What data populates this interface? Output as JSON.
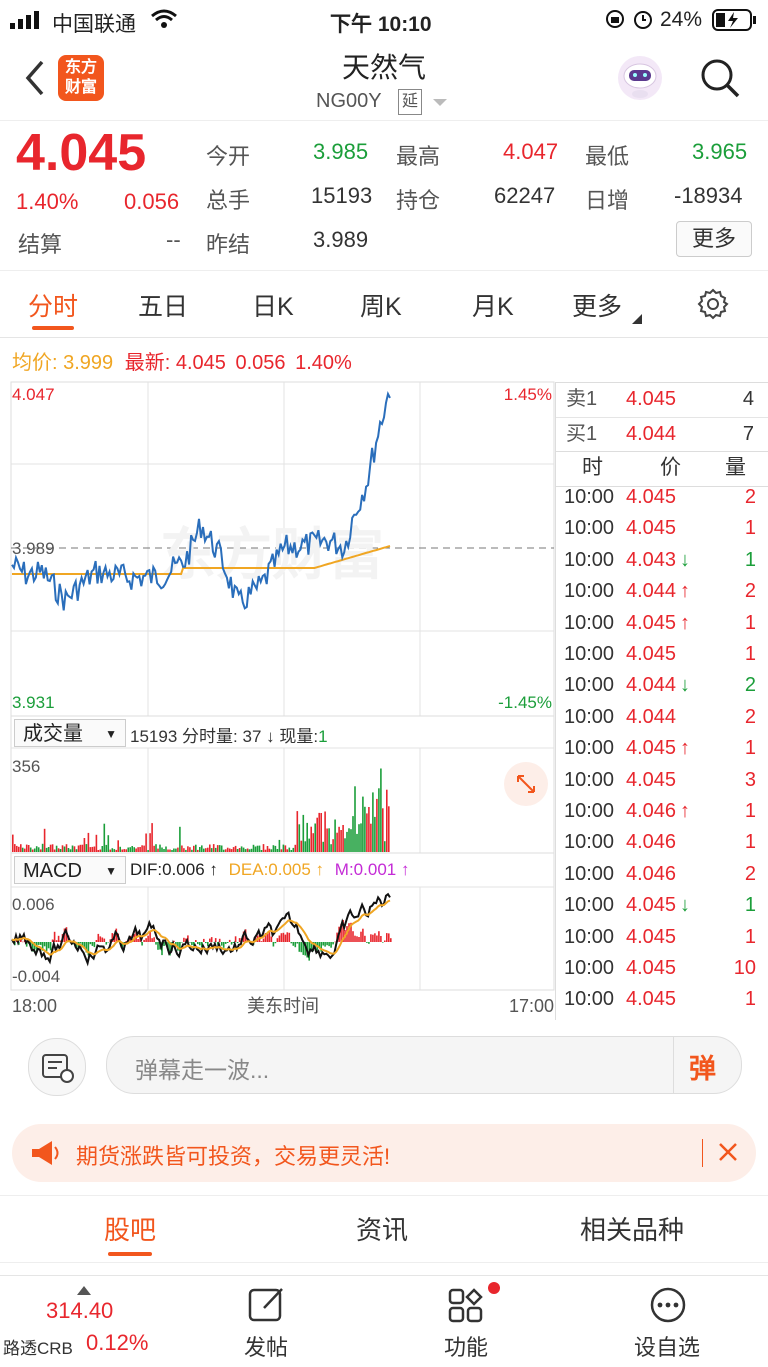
{
  "status_bar": {
    "carrier": "中国联通",
    "time": "下午 10:10",
    "battery": "24%"
  },
  "header": {
    "back_icon": "back-arrow-icon",
    "logo_line1": "东方",
    "logo_line2": "财富",
    "title": "天然气",
    "code": "NG00Y",
    "delay_badge": "延"
  },
  "quote": {
    "price": "4.045",
    "change_pct": "1.40%",
    "change": "0.056",
    "settle_label": "结算",
    "settle_value": "--",
    "open_label": "今开",
    "open_value": "3.985",
    "high_label": "最高",
    "high_value": "4.047",
    "low_label": "最低",
    "low_value": "3.965",
    "volume_label": "总手",
    "volume_value": "15193",
    "oi_label": "持仓",
    "oi_value": "62247",
    "daily_inc_label": "日增",
    "daily_inc_value": "-18934",
    "prev_settle_label": "昨结",
    "prev_settle_value": "3.989",
    "more_button": "更多"
  },
  "tabs": [
    "分时",
    "五日",
    "日K",
    "周K",
    "月K",
    "更多"
  ],
  "chart_header": {
    "avg_label": "均价:",
    "avg_value": "3.999",
    "latest_label": "最新:",
    "latest_value": "4.045",
    "latest_change": "0.056",
    "latest_pct": "1.40%"
  },
  "price_chart": {
    "top_label": "4.047",
    "mid_label": "3.989",
    "bottom_label": "3.931",
    "top_pct": "1.45%",
    "bottom_pct": "-1.45%",
    "watermark": "东方财富"
  },
  "volume_panel": {
    "selector": "成交量",
    "total": "15193",
    "bar_vol_label": "分时量:",
    "bar_vol_value": "37 ↓",
    "cur_vol_label": "现量:",
    "cur_vol_value": "1",
    "max_label": "356"
  },
  "macd_panel": {
    "selector": "MACD",
    "dif": "DIF:0.006 ↑",
    "dea": "DEA:0.005 ↑",
    "m": "M:0.001 ↑",
    "top_label": "0.006",
    "bottom_label": "-0.004"
  },
  "time_axis": {
    "start": "18:00",
    "middle": "美东时间",
    "end": "17:00"
  },
  "order_book": {
    "sell_label": "卖1",
    "sell_price": "4.045",
    "sell_qty": "4",
    "buy_label": "买1",
    "buy_price": "4.044",
    "buy_qty": "7"
  },
  "ticks_header": {
    "time": "时",
    "price": "价",
    "qty": "量"
  },
  "ticks": [
    {
      "time": "10:00",
      "price": "4.045",
      "arrow": "",
      "qty": "2"
    },
    {
      "time": "10:00",
      "price": "4.045",
      "arrow": "",
      "qty": "1"
    },
    {
      "time": "10:00",
      "price": "4.043",
      "arrow": "↓",
      "qty": "1"
    },
    {
      "time": "10:00",
      "price": "4.044",
      "arrow": "↑",
      "qty": "2"
    },
    {
      "time": "10:00",
      "price": "4.045",
      "arrow": "↑",
      "qty": "1"
    },
    {
      "time": "10:00",
      "price": "4.045",
      "arrow": "",
      "qty": "1"
    },
    {
      "time": "10:00",
      "price": "4.044",
      "arrow": "↓",
      "qty": "2"
    },
    {
      "time": "10:00",
      "price": "4.044",
      "arrow": "",
      "qty": "2"
    },
    {
      "time": "10:00",
      "price": "4.045",
      "arrow": "↑",
      "qty": "1"
    },
    {
      "time": "10:00",
      "price": "4.045",
      "arrow": "",
      "qty": "3"
    },
    {
      "time": "10:00",
      "price": "4.046",
      "arrow": "↑",
      "qty": "1"
    },
    {
      "time": "10:00",
      "price": "4.046",
      "arrow": "",
      "qty": "1"
    },
    {
      "time": "10:00",
      "price": "4.046",
      "arrow": "",
      "qty": "2"
    },
    {
      "time": "10:00",
      "price": "4.045",
      "arrow": "↓",
      "qty": "1"
    },
    {
      "time": "10:00",
      "price": "4.045",
      "arrow": "",
      "qty": "1"
    },
    {
      "time": "10:00",
      "price": "4.045",
      "arrow": "",
      "qty": "10"
    },
    {
      "time": "10:00",
      "price": "4.045",
      "arrow": "",
      "qty": "1"
    }
  ],
  "danmu": {
    "placeholder": "弹幕走一波...",
    "send_icon": "弹"
  },
  "ad": {
    "text": "期货涨跌皆可投资，交易更灵活!"
  },
  "sub_tabs": [
    "股吧",
    "资讯",
    "相关品种"
  ],
  "bottom_bar": {
    "index_value": "314.40",
    "index_name": "路透CRB",
    "index_pct": "0.12%",
    "post": "发帖",
    "functions": "功能",
    "watchlist": "设自选"
  },
  "colors": {
    "up": "#e8262d",
    "down": "#1b9e3a",
    "accent": "#f2561d",
    "price_line": "#2a6ebb",
    "avg_line": "#f0a623"
  }
}
